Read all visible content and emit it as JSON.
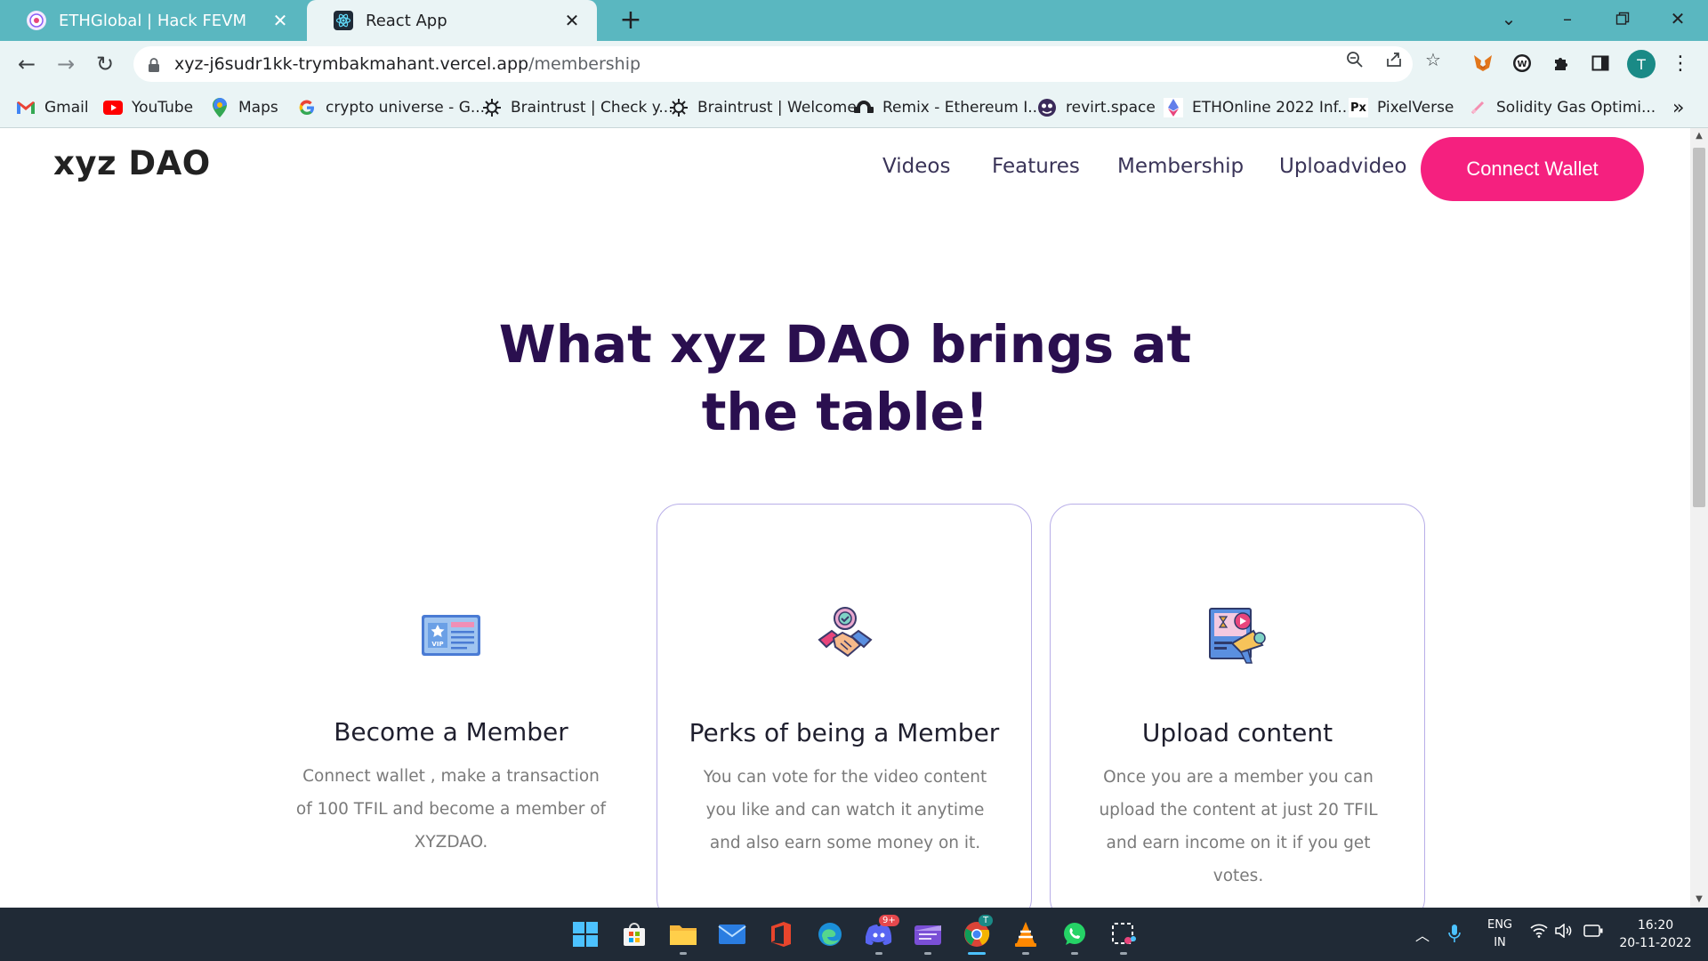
{
  "browser": {
    "tabs": [
      {
        "title": "ETHGlobal | Hack FEVM",
        "active": false,
        "icon": "ethglobal-icon"
      },
      {
        "title": "React App",
        "active": true,
        "icon": "react-icon"
      }
    ],
    "new_tab_label": "+",
    "address": {
      "host": "xyz-j6sudr1kk-trymbakmahant.vercel.app",
      "path": "/membership"
    },
    "profile_initial": "T",
    "bookmarks": [
      {
        "label": "Gmail",
        "icon": "gmail-icon"
      },
      {
        "label": "YouTube",
        "icon": "youtube-icon"
      },
      {
        "label": "Maps",
        "icon": "maps-icon"
      },
      {
        "label": "crypto universe - G...",
        "icon": "google-icon"
      },
      {
        "label": "Braintrust | Check y...",
        "icon": "braintrust-icon"
      },
      {
        "label": "Braintrust | Welcome",
        "icon": "braintrust-icon"
      },
      {
        "label": "Remix - Ethereum I...",
        "icon": "remix-icon"
      },
      {
        "label": "revirt.space",
        "icon": "revirt-icon"
      },
      {
        "label": "ETHOnline 2022 Inf...",
        "icon": "ethereum-icon"
      },
      {
        "label": "PixelVerse",
        "icon": "pixelverse-icon"
      },
      {
        "label": "Solidity Gas Optimi...",
        "icon": "solidity-icon"
      }
    ],
    "bookmark_badge": "Px",
    "bookmarks_overflow": "»"
  },
  "site": {
    "logo": "xyz DAO",
    "nav": [
      "Videos",
      "Features",
      "Membership",
      "Uploadvideo"
    ],
    "connect_button": "Connect Wallet",
    "hero_line1": "What xyz DAO brings at",
    "hero_line2": "the table!",
    "cards": [
      {
        "title": "Become a Member",
        "description": "Connect wallet , make a transaction of 100 TFIL and become a member of XYZDAO.",
        "icon": "vip-card-icon"
      },
      {
        "title": "Perks of being a Member",
        "description": "You can vote for the video content you like and can watch it anytime and also earn some money on it.",
        "icon": "handshake-badge-icon"
      },
      {
        "title": "Upload content",
        "description": "Once you are a member you can upload the content at just 20 TFIL and earn income on it if you get votes.",
        "icon": "video-megaphone-icon"
      }
    ]
  },
  "taskbar": {
    "discord_badge": "9+",
    "chrome_badge": "T",
    "language": "ENG",
    "region": "IN",
    "time": "16:20",
    "date": "20-11-2022"
  },
  "colors": {
    "tabstrip": "#5ab7c0",
    "toolbar": "#eaf4f5",
    "accent_pink": "#f5207f",
    "hero_text": "#2a0f4f",
    "card_border": "#b8aee8",
    "taskbar": "#202a36"
  }
}
